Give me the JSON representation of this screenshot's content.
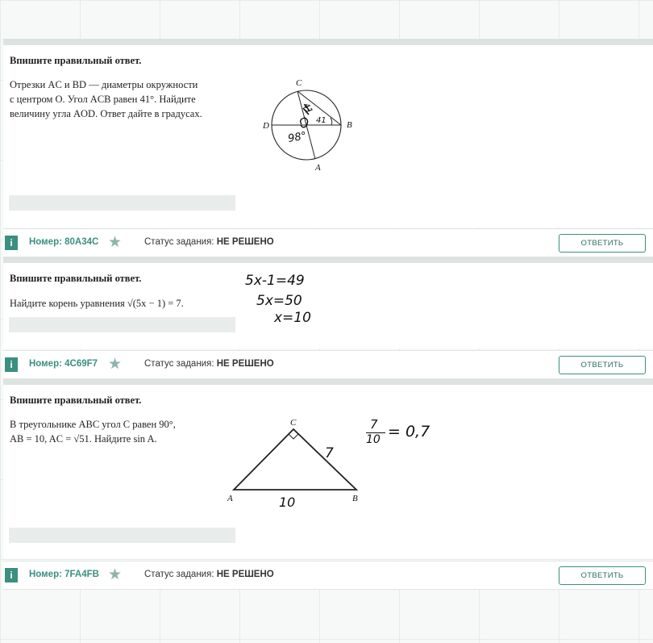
{
  "tasks": [
    {
      "title": "Впишите правильный ответ.",
      "text_lines": [
        "Отрезки AC и BD — диаметры окружности",
        "с центром O. Угол ACB равен 41°. Найдите",
        "величину угла AOD. Ответ дайте в градусах."
      ],
      "figure_labels": {
        "c": "C",
        "d": "D",
        "b": "B",
        "a": "A"
      },
      "handwriting": [
        "41",
        "41",
        "98°"
      ],
      "number_label": "Номер:",
      "number": "80A34C",
      "status_label": "Статус задания:",
      "status": "НЕ РЕШЕНО",
      "button": "ОТВЕТИТЬ"
    },
    {
      "title": "Впишите правильный ответ.",
      "text": "Найдите корень уравнения √(5x − 1) = 7.",
      "handwriting": [
        "5x-1=49",
        "5x=50",
        "x=10"
      ],
      "number_label": "Номер:",
      "number": "4C69F7",
      "status_label": "Статус задания:",
      "status": "НЕ РЕШЕНО",
      "button": "ОТВЕТИТЬ"
    },
    {
      "title": "Впишите правильный ответ.",
      "text_lines": [
        "В треугольнике ABC угол C равен 90°,",
        "AB = 10, AC = √51. Найдите sin A."
      ],
      "figure_labels": {
        "c": "C",
        "a": "A",
        "b": "B"
      },
      "handwriting": [
        "7",
        "10",
        "7",
        "10",
        "= 0,7"
      ],
      "number_label": "Номер:",
      "number": "7FA4FB",
      "status_label": "Статус задания:",
      "status": "НЕ РЕШЕНО",
      "button": "ОТВЕТИТЬ"
    }
  ]
}
